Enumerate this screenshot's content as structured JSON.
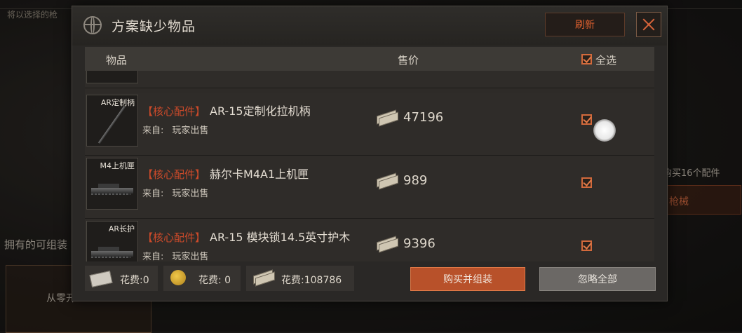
{
  "background": {
    "hint_text": "将以选择的枪",
    "owned_title": "拥有的可组装",
    "from_scratch_label": "从零开",
    "buy_parts_text": "购买16个配件",
    "gun_button_label": "枪械"
  },
  "dialog": {
    "title": "方案缺少物品",
    "refresh_label": "刷新",
    "columns": {
      "item": "物品",
      "price": "售价",
      "select_all": "全选"
    },
    "items": [
      {
        "thumb_label": "AR定制柄",
        "tag": "【核心配件】",
        "name": "AR-15定制化拉机柄",
        "from_label": "来自:",
        "source": "玩家出售",
        "price": "47196",
        "checked": true
      },
      {
        "thumb_label": "M4上机匣",
        "tag": "【核心配件】",
        "name": "赫尔卡M4A1上机匣",
        "from_label": "来自:",
        "source": "玩家出售",
        "price": "989",
        "checked": true
      },
      {
        "thumb_label": "AR长护",
        "tag": "【核心配件】",
        "name": "AR-15 模块锁14.5英寸护木",
        "from_label": "来自:",
        "source": "玩家出售",
        "price": "9396",
        "checked": true
      }
    ],
    "footer": {
      "cost_ticket": "花费:0",
      "cost_coin": "花费: 0",
      "cost_cash": "花费:108786",
      "buy_label": "购买并组装",
      "ignore_label": "忽略全部"
    }
  },
  "colors": {
    "accent": "#d7643a",
    "tag_red": "#cc4a2a",
    "buy_button": "#b8512a"
  }
}
